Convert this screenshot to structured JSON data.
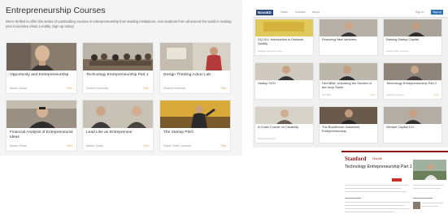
{
  "panel1": {
    "title": "Entrepreneurship Courses",
    "intro": "We're thrilled to offer this series of outstanding courses in entrepreneurship from leading institutions. Join students from all around the world in making your innovative ideas a reality. Sign up today!",
    "courses": [
      {
        "title": "Opportunity and Entrepreneurship",
        "institution": "Babson Global",
        "price": "Free"
      },
      {
        "title": "Technology Entrepreneurship Part 1",
        "institution": "Stanford University",
        "price": "Free"
      },
      {
        "title": "Design Thinking Action Lab",
        "institution": "Stanford University",
        "price": "Free"
      },
      {
        "title": "Financial Analysis of Entrepreneurial Ideas",
        "institution": "Babson Global",
        "price": "Free"
      },
      {
        "title": "Lead Like an Entrepreneur",
        "institution": "Babson Global",
        "price": "Free"
      },
      {
        "title": "The Startup Pitch",
        "institution": "Draper Fisher Jurvetson",
        "price": "Free"
      }
    ]
  },
  "panel2": {
    "logo": "NovoED",
    "nav": [
      "Home",
      "Courses",
      "About"
    ],
    "signin": "Sign in",
    "signup": "Sign up",
    "courses": [
      {
        "title": "DQ 101: Introduction to Decision Quality",
        "institution": "Strategic Decisions Group",
        "price": ""
      },
      {
        "title": "Financing New Ventures",
        "institution": "",
        "price": ""
      },
      {
        "title": "Raising Startup Capital",
        "institution": "Draper Fisher Jurvetson",
        "price": ""
      },
      {
        "title": "Startup CEO",
        "institution": "",
        "price": ""
      },
      {
        "title": "Hint MBA: Unlocking the Secrets of the Ivory Tower",
        "institution": "Hint MBA",
        "price": "Free"
      },
      {
        "title": "Technology Entrepreneurship Part 2",
        "institution": "Stanford University",
        "price": "Free"
      },
      {
        "title": "A Crash Course on Creativity",
        "institution": "Stanford University",
        "price": ""
      },
      {
        "title": "The Boardroom: Advanced Entrepreneurship",
        "institution": "",
        "price": ""
      },
      {
        "title": "Venture Capital 101",
        "institution": "",
        "price": ""
      }
    ]
  },
  "panel3": {
    "brand": "Stanford",
    "brand_sub": "ONLINE",
    "course_title": "Technology Entrepreneurship Part 1"
  },
  "colors": {
    "accent_orange": "#e2a03f",
    "stanford_red": "#8c1515",
    "novoed_blue": "#2a4a7a"
  }
}
